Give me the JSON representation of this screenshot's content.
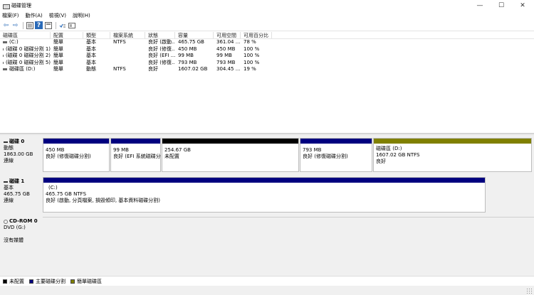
{
  "window": {
    "title": "磁碟管理",
    "minimize": "—",
    "maximize": "☐",
    "close": "✕"
  },
  "menu": [
    "檔案(F)",
    "動作(A)",
    "檢視(V)",
    "說明(H)"
  ],
  "toolbar": {
    "back": "⇦",
    "forward": "⇨",
    "help": "?"
  },
  "volume_table": {
    "headers": [
      "磁碟區",
      "配置",
      "類型",
      "檔案系統",
      "狀態",
      "容量",
      "可用空間",
      "可用百分比"
    ],
    "rows": [
      [
        "(C:)",
        "簡單",
        "基本",
        "NTFS",
        "良好 (啟動...",
        "465.75 GB",
        "361.04 ...",
        "78 %"
      ],
      [
        "(磁碟 0 磁碟分割 1)",
        "簡單",
        "基本",
        "",
        "良好 (修復...",
        "450 MB",
        "450 MB",
        "100 %"
      ],
      [
        "(磁碟 0 磁碟分割 2)",
        "簡單",
        "基本",
        "",
        "良好 (EFI ...",
        "99 MB",
        "99 MB",
        "100 %"
      ],
      [
        "(磁碟 0 磁碟分割 5)",
        "簡單",
        "基本",
        "",
        "良好 (修復...",
        "793 MB",
        "793 MB",
        "100 %"
      ],
      [
        "磁碟區 (D:)",
        "簡單",
        "動態",
        "NTFS",
        "良好",
        "1607.02 GB",
        "304.45 ...",
        "19 %"
      ]
    ]
  },
  "disks": [
    {
      "name": "磁碟 0",
      "type": "動態",
      "size": "1863.00 GB",
      "status": "連線",
      "partitions": [
        {
          "line1": "450 MB",
          "line2": "良好 (修復磁碟分割)",
          "color": "#00007f"
        },
        {
          "line1": "99 MB",
          "line2": "良好 (EFI 系統磁碟分",
          "color": "#00007f"
        },
        {
          "line1": "254.67 GB",
          "line2": "未配置",
          "color": "#000000"
        },
        {
          "line1": "793 MB",
          "line2": "良好 (修復磁碟分割)",
          "color": "#00007f"
        },
        {
          "title": "磁碟區 (D:)",
          "line1": "1607.02 GB NTFS",
          "line2": "良好",
          "color": "#808000"
        }
      ]
    },
    {
      "name": "磁碟 1",
      "type": "基本",
      "size": "465.75 GB",
      "status": "連線",
      "partitions": [
        {
          "title": "(C:)",
          "line1": "465.75 GB NTFS",
          "line2": "良好 (啟動, 分頁檔案, 損毀傾印, 基本資料磁碟分割)",
          "color": "#00007f"
        }
      ]
    },
    {
      "name": "CD-ROM 0",
      "type": "DVD (G:)",
      "size": "",
      "status": "沒有媒體"
    }
  ],
  "legend": [
    {
      "label": "未配置",
      "color": "#000000"
    },
    {
      "label": "主要磁碟分割",
      "color": "#00007f"
    },
    {
      "label": "簡單磁碟區",
      "color": "#808000"
    }
  ]
}
